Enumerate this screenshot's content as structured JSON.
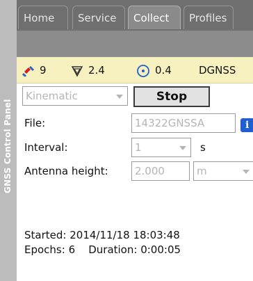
{
  "sidebar": {
    "title": "GNSS Control Panel"
  },
  "tabs": [
    {
      "label": "Home"
    },
    {
      "label": "Service"
    },
    {
      "label": "Collect",
      "active": true
    },
    {
      "label": "Profiles"
    }
  ],
  "status": {
    "satellites": "9",
    "pdop": "2.4",
    "precision": "0.4",
    "solution": "DGNSS"
  },
  "form": {
    "mode_value": "Kinematic",
    "stop_label": "Stop",
    "file_label": "File:",
    "file_value": "14322GNSSA",
    "interval_label": "Interval:",
    "interval_value": "1",
    "interval_unit": "s",
    "antenna_label": "Antenna height:",
    "antenna_value": "2.000",
    "antenna_unit": "m"
  },
  "session": {
    "started_label": "Started:",
    "started_value": "2014/11/18 18:03:48",
    "epochs_label": "Epochs:",
    "epochs_value": "6",
    "duration_label": "Duration:",
    "duration_value": "0:00:05"
  },
  "colors": {
    "status_bg": "#f7f1c0",
    "tab_bar": "#6f6f6f",
    "accent_blue": "#1f5fd0",
    "satellite_red": "#d02020"
  }
}
